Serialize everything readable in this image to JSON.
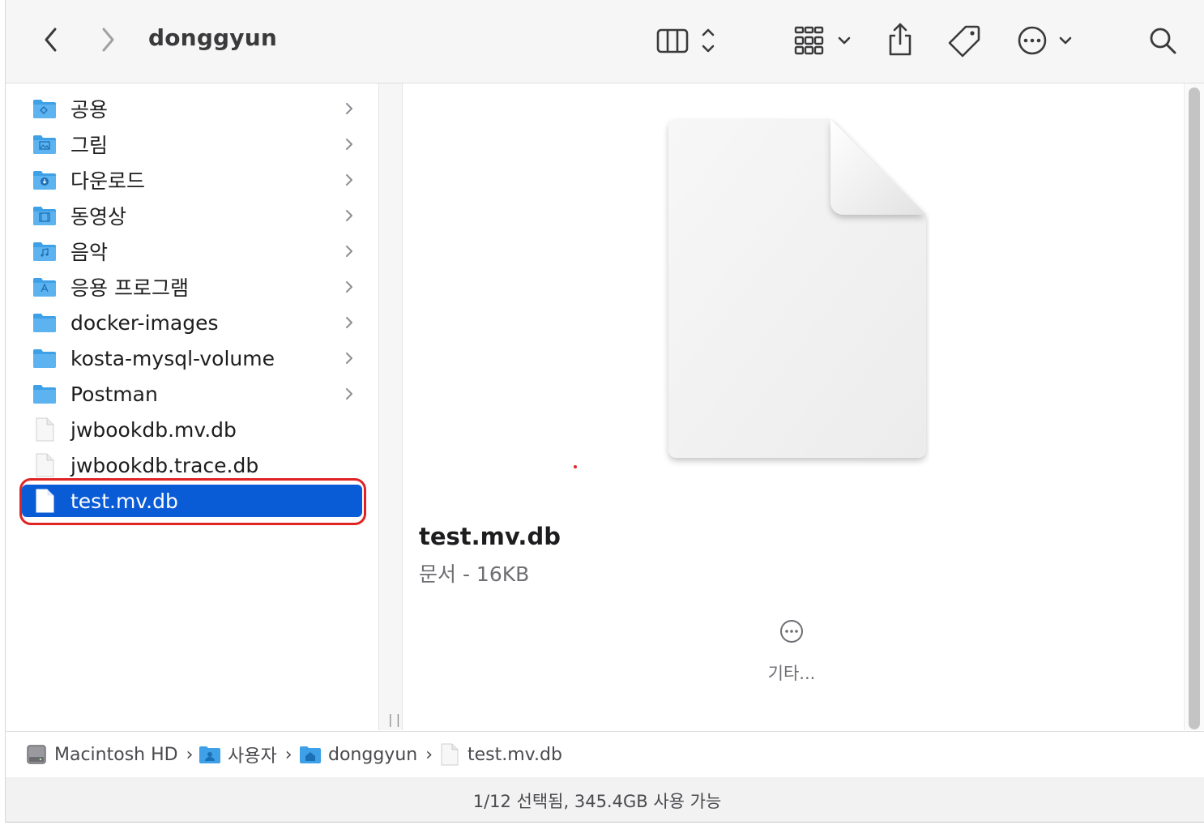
{
  "window": {
    "title": "donggyun"
  },
  "toolbar": {
    "back_icon": "chevron-left-icon",
    "forward_icon": "chevron-right-icon",
    "view_icon": "columns-view-icon",
    "group_icon": "grid-group-icon",
    "share_icon": "share-icon",
    "tag_icon": "tag-icon",
    "actions_icon": "ellipsis-circle-icon",
    "search_icon": "search-icon"
  },
  "column": {
    "items": [
      {
        "label": "공용",
        "icon": "folder-public-icon",
        "has_children": true
      },
      {
        "label": "그림",
        "icon": "folder-pictures-icon",
        "has_children": true
      },
      {
        "label": "다운로드",
        "icon": "folder-downloads-icon",
        "has_children": true
      },
      {
        "label": "동영상",
        "icon": "folder-movies-icon",
        "has_children": true
      },
      {
        "label": "음악",
        "icon": "folder-music-icon",
        "has_children": true
      },
      {
        "label": "응용 프로그램",
        "icon": "folder-applications-icon",
        "has_children": true
      },
      {
        "label": "docker-images",
        "icon": "folder-icon",
        "has_children": true
      },
      {
        "label": "kosta-mysql-volume",
        "icon": "folder-icon",
        "has_children": true
      },
      {
        "label": "Postman",
        "icon": "folder-icon",
        "has_children": true
      },
      {
        "label": "jwbookdb.mv.db",
        "icon": "document-icon",
        "has_children": false
      },
      {
        "label": "jwbookdb.trace.db",
        "icon": "document-icon",
        "has_children": false
      },
      {
        "label": "test.mv.db",
        "icon": "document-icon",
        "has_children": false,
        "selected": true
      }
    ]
  },
  "preview": {
    "name": "test.mv.db",
    "kind_size": "문서 - 16KB",
    "more_label": "기타..."
  },
  "pathbar": {
    "crumbs": [
      {
        "label": "Macintosh HD",
        "icon": "hard-drive-icon"
      },
      {
        "label": "사용자",
        "icon": "folder-users-icon"
      },
      {
        "label": "donggyun",
        "icon": "folder-home-icon"
      },
      {
        "label": "test.mv.db",
        "icon": "document-icon"
      }
    ]
  },
  "status": {
    "text": "1/12 선택됨, 345.4GB 사용 가능"
  },
  "colors": {
    "selection": "#0a5bd6",
    "highlight_ring": "#e02424",
    "folder": "#3ea0e6"
  }
}
